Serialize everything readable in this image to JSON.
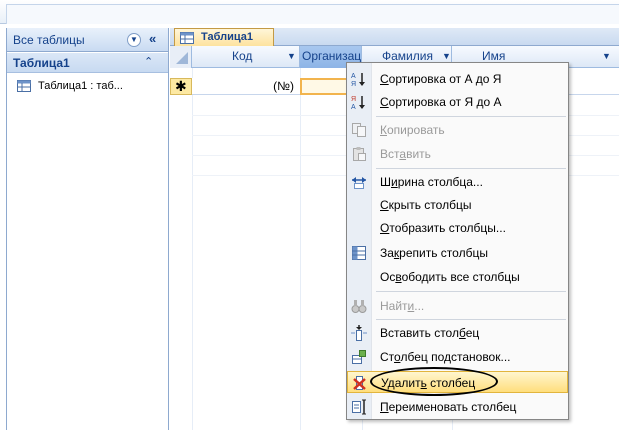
{
  "nav": {
    "title": "Все таблицы",
    "group": "Таблица1",
    "item": "Таблица1 : таб..."
  },
  "doc": {
    "tab": "Таблица1"
  },
  "sheet": {
    "columns": [
      "Код",
      "Организаци",
      "Фамилия",
      "Имя"
    ],
    "new_record_marker": "✱",
    "id_placeholder": "(№)"
  },
  "menu": {
    "items": [
      {
        "pre": "",
        "u": "С",
        "post": "ортировка от А до Я",
        "icon": "sort-asc-icon",
        "enabled": true
      },
      {
        "pre": "",
        "u": "С",
        "post": "ортировка от Я до А",
        "icon": "sort-desc-icon",
        "enabled": true
      },
      {
        "pre": "",
        "u": "К",
        "post": "опировать",
        "icon": "copy-icon",
        "enabled": false
      },
      {
        "pre": "Вст",
        "u": "а",
        "post": "вить",
        "icon": "paste-icon",
        "enabled": false
      },
      {
        "pre": "Ш",
        "u": "и",
        "post": "рина столбца...",
        "icon": "column-width-icon",
        "enabled": true
      },
      {
        "pre": "",
        "u": "С",
        "post": "крыть столбцы",
        "icon": "",
        "enabled": true
      },
      {
        "pre": "",
        "u": "О",
        "post": "тобразить столбцы...",
        "icon": "",
        "enabled": true
      },
      {
        "pre": "За",
        "u": "к",
        "post": "репить столбцы",
        "icon": "freeze-columns-icon",
        "enabled": true
      },
      {
        "pre": "Ос",
        "u": "в",
        "post": "ободить все столбцы",
        "icon": "",
        "enabled": true
      },
      {
        "pre": "Найт",
        "u": "и",
        "post": "...",
        "icon": "binoculars-icon",
        "enabled": false
      },
      {
        "pre": "Вставить стол",
        "u": "б",
        "post": "ец",
        "icon": "insert-column-icon",
        "enabled": true
      },
      {
        "pre": "Ст",
        "u": "о",
        "post": "лбец подстановок...",
        "icon": "lookup-column-icon",
        "enabled": true
      },
      {
        "pre": "Удалит",
        "u": "ь",
        "post": " столбец",
        "icon": "delete-column-icon",
        "enabled": true
      },
      {
        "pre": "",
        "u": "П",
        "post": "ереименовать столбец",
        "icon": "rename-column-icon",
        "enabled": true
      }
    ]
  }
}
